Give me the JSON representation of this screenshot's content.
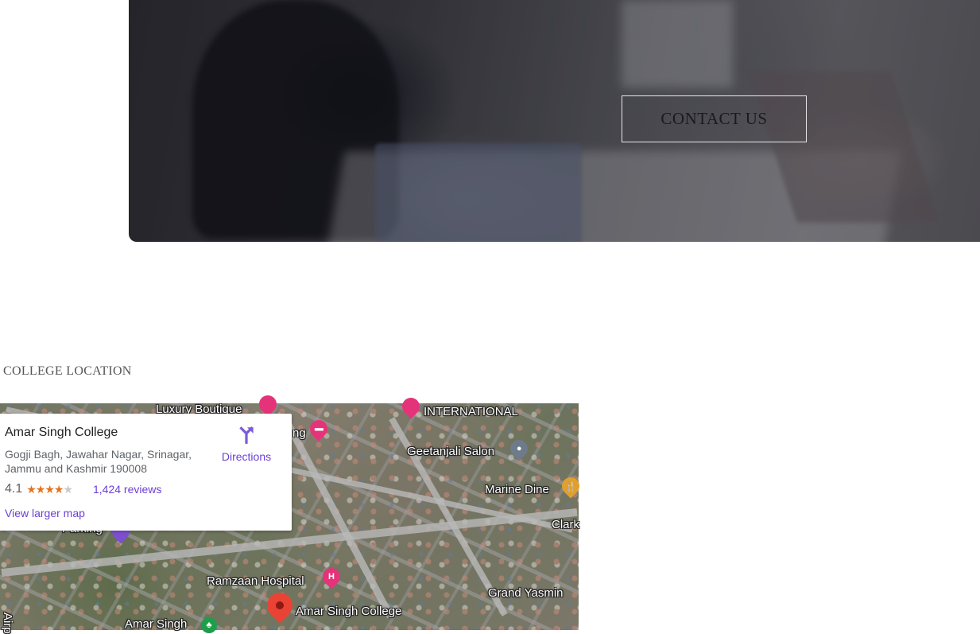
{
  "hero": {
    "contact_button": "CONTACT US"
  },
  "location_section": {
    "heading": "COLLEGE LOCATION"
  },
  "map_card": {
    "place_name": "Amar Singh College",
    "address": "Gogji Bagh, Jawahar Nagar, Srinagar, Jammu and Kashmir 190008",
    "rating": "4.1",
    "stars_filled": 4,
    "reviews_link": "1,424 reviews",
    "larger_map_link": "View larger map",
    "directions_label": "Directions",
    "directions_icon": "directions-icon"
  },
  "map_labels": {
    "luxury_boutique": "Luxury Boutique",
    "lodging_partial": "ng",
    "international": "INTERNATIONAL",
    "geetanjali_salon": "Geetanjali Salon",
    "marine_dine": "Marine Dine",
    "clark_partial": "Clark",
    "parking": "Parking",
    "ramzaan_hospital": "Ramzaan Hospital",
    "amar_singh_college": "Amar Singh College",
    "grand_yasmin": "Grand Yasmin",
    "amar_singh": "Amar Singh",
    "airport_partial": "Airp"
  },
  "colors": {
    "link": "#6b3fd6",
    "marker_red": "#ea4335",
    "poi_pink": "#e5337a"
  }
}
